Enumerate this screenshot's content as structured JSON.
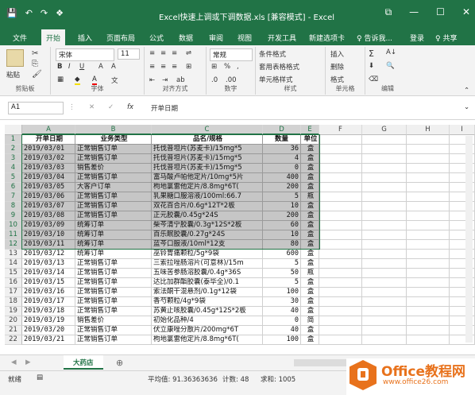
{
  "title": "Excel快速上调或下调数据.xls [兼容模式] - Excel",
  "window": {
    "restore": "⧉",
    "min": "—",
    "max": "☐",
    "close": "✕"
  },
  "qat": [
    "💾",
    "↶",
    "↷",
    "❖"
  ],
  "tabs": [
    "文件",
    "开始",
    "插入",
    "页面布局",
    "公式",
    "数据",
    "审阅",
    "视图",
    "开发工具",
    "新建选项卡",
    "♀ 告诉我...",
    "登录",
    "♀ 共享"
  ],
  "ribbon": {
    "paste": "粘贴",
    "clipboard": "剪贴板",
    "font_name": "宋体",
    "font_size": "11",
    "font": "字体",
    "align": "对齐方式",
    "numfmt": "常规",
    "number": "数字",
    "cond": "条件格式",
    "table": "套用表格格式",
    "cellstyle": "单元格样式",
    "styles": "样式",
    "insert": "插入",
    "delete": "删除",
    "format": "格式",
    "cells": "单元格",
    "editing": "编辑"
  },
  "formula": {
    "namebox": "A1",
    "fx": "fx",
    "value": "开单日期"
  },
  "columns": [
    "A",
    "B",
    "C",
    "D",
    "E",
    "F",
    "G",
    "H",
    "I"
  ],
  "table": {
    "header": [
      "开单日期",
      "业务类型",
      "品名/规格",
      "数量",
      "单位"
    ],
    "rows": [
      [
        "2019/03/01",
        "正常销售订单",
        "托伐普坦片(苏麦卡)/15mg*5",
        "36",
        "盒"
      ],
      [
        "2019/03/02",
        "正常销售订单",
        "托伐普坦片(苏麦卡)/15mg*5",
        "4",
        "盒"
      ],
      [
        "2019/03/03",
        "销售差价",
        "托伐普坦片(苏麦卡)/15mg*5",
        "0",
        "盒"
      ],
      [
        "2019/03/04",
        "正常销售订单",
        "富马酸卢帕他定片/10mg*5片",
        "400",
        "盒"
      ],
      [
        "2019/03/05",
        "大客户订单",
        "枸地氯雷他定片/8.8mg*6T(",
        "200",
        "盒"
      ],
      [
        "2019/03/06",
        "正常销售订单",
        "乳果糖口服溶液/100ml:66.7",
        "5",
        "瓶"
      ],
      [
        "2019/03/07",
        "正常销售订单",
        "双花百合片/0.6g*12T*2板",
        "10",
        "盒"
      ],
      [
        "2019/03/08",
        "正常销售订单",
        "正元胶囊/0.45g*24S",
        "200",
        "盒"
      ],
      [
        "2019/03/09",
        "统筹订单",
        "柴芩清宁胶囊/0.3g*12S*2板",
        "60",
        "盒"
      ],
      [
        "2019/03/10",
        "统筹订单",
        "百乐眠胶囊/0.27g*24S",
        "10",
        "盒"
      ],
      [
        "2019/03/11",
        "统筹订单",
        "蓝芩口服液/10ml*12支",
        "80",
        "盒"
      ],
      [
        "2019/03/12",
        "统筹订单",
        "巫铃胃痛颗粒/5g*9袋",
        "600",
        "盒"
      ],
      [
        "2019/03/13",
        "正常销售订单",
        "三索拉唑肠溶片(可意林)/15m",
        "5",
        "盒"
      ],
      [
        "2019/03/14",
        "正常销售订单",
        "五味苦参肠溶胶囊/0.4g*36S",
        "50",
        "瓶"
      ],
      [
        "2019/03/15",
        "正常销售订单",
        "达比加群酯胶囊(泰毕全)/0.1",
        "5",
        "盒"
      ],
      [
        "2019/03/16",
        "正常销售订单",
        "索法酮干混悬剂/0.1g*12袋",
        "100",
        "盒"
      ],
      [
        "2019/03/17",
        "正常销售订单",
        "香芍颗粒/4g*9袋",
        "30",
        "盒"
      ],
      [
        "2019/03/18",
        "正常销售订单",
        "苏黄止咳胶囊/0.45g*12S*2板",
        "40",
        "盒"
      ],
      [
        "2019/03/19",
        "销售差价",
        "初始化品种/4",
        "0",
        "简"
      ],
      [
        "2019/03/20",
        "正常销售订单",
        "伏立康唑分散片/200mg*6T",
        "40",
        "盒"
      ],
      [
        "2019/03/21",
        "正常销售订单",
        "枸地氯雷他定片/8.8mg*6T(",
        "100",
        "盒"
      ]
    ]
  },
  "row_numbers": [
    "1",
    "2",
    "3",
    "4",
    "5",
    "6",
    "7",
    "8",
    "9",
    "10",
    "11",
    "12",
    "13",
    "14",
    "15",
    "16",
    "17",
    "18",
    "19",
    "20",
    "21",
    "22"
  ],
  "sheet": {
    "name": "大药店",
    "add": "⊕"
  },
  "status": {
    "mode": "就绪",
    "avg": "平均值: 91.36363636",
    "count": "计数: 48",
    "sum": "求和: 1005"
  },
  "watermark": {
    "line1": "Office教程网",
    "line2": "www.office26.com"
  },
  "colors": {
    "accent": "#217346",
    "selected": "#c6c6c6",
    "logo": "#e8721c"
  }
}
